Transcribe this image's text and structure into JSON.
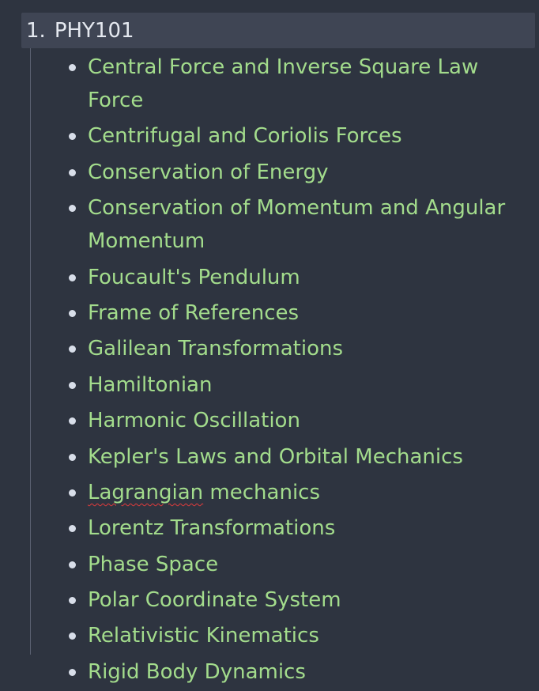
{
  "outline": {
    "header": {
      "number": "1.",
      "title": "PHY101"
    },
    "items": [
      {
        "text": "Central Force and Inverse Square Law Force"
      },
      {
        "text": "Centrifugal and Coriolis Forces"
      },
      {
        "text": "Conservation of Energy"
      },
      {
        "text": "Conservation of Momentum and Angular Momentum"
      },
      {
        "text": "Foucault's Pendulum"
      },
      {
        "text": "Frame of References"
      },
      {
        "text": "Galilean Transformations"
      },
      {
        "text": "Hamiltonian"
      },
      {
        "text": "Harmonic Oscillation"
      },
      {
        "text": "Kepler's Laws and Orbital Mechanics"
      },
      {
        "misspelled": "Lagrangian",
        "rest": " mechanics"
      },
      {
        "text": "Lorentz Transformations"
      },
      {
        "text": "Phase Space"
      },
      {
        "text": "Polar Coordinate System"
      },
      {
        "text": "Relativistic Kinematics"
      },
      {
        "text": "Rigid Body Dynamics"
      }
    ]
  },
  "colors": {
    "background": "#2e3440",
    "header_background": "#3f4554",
    "header_text": "#e5e9f0",
    "item_text": "#a3dc8c",
    "bullet": "#d8dee9",
    "spellcheck_underline": "#e23b3b"
  }
}
